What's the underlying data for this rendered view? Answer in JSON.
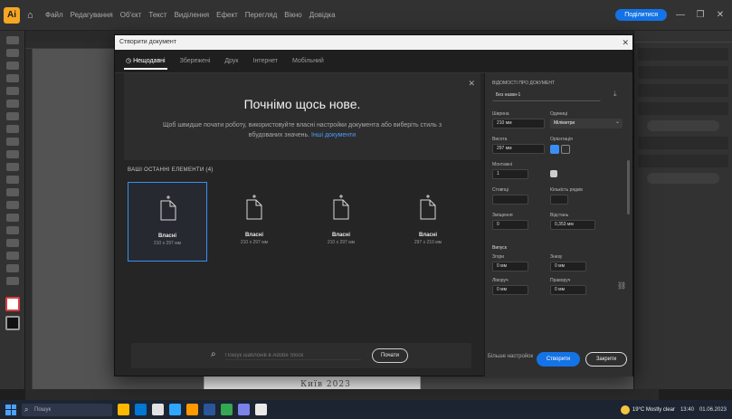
{
  "colors": {
    "accent": "#1473e6",
    "selection": "#3a8ef5",
    "link": "#4b9cff"
  },
  "app": {
    "logo_text": "Ai",
    "menu": [
      "Файл",
      "Редагування",
      "Об'єкт",
      "Текст",
      "Виділення",
      "Ефект",
      "Перегляд",
      "Вікно",
      "Довідка"
    ],
    "share_label": "Поділитися",
    "window_controls": [
      "—",
      "❐",
      "✕"
    ]
  },
  "dialog": {
    "title": "Створити документ",
    "tabs": [
      "Нещодавні",
      "Збережені",
      "Друк",
      "Інтернет",
      "Мобільний"
    ],
    "hero": {
      "title": "Почнімо щось нове.",
      "text": "Щоб швидше почати роботу, використовуйте власні настройки документа або виберіть стиль з вбудованих значень.",
      "link_text": "Інші документи"
    },
    "section_label": "ВАШІ ОСТАННІ ЕЛЕМЕНТИ (4)",
    "presets": [
      {
        "name": "Власні",
        "size": "210 x 297 мм"
      },
      {
        "name": "Власні",
        "size": "210 x 297 мм"
      },
      {
        "name": "Власні",
        "size": "210 x 297 мм"
      },
      {
        "name": "Власні",
        "size": "297 x 210 мм"
      }
    ],
    "search": {
      "placeholder": "Пошук шаблонів в Adobe Stock",
      "button": "Почати"
    },
    "details": {
      "header": "ВІДОМОСТІ ПРО ДОКУМЕНТ",
      "name_value": "Без назви-1",
      "width_label": "Ширина",
      "width_value": "210 мм",
      "units_label": "Одиниці",
      "units_value": "Міліметри",
      "height_label": "Висота",
      "height_value": "297 мм",
      "orientation_label": "Орієнтація",
      "artboards_label": "Монтажні",
      "artboards_value": "1",
      "columns_label": "Стовпці",
      "rows_label": "Кількість рядків",
      "bleed_label": "Випуск",
      "bleed_top_label": "Згори",
      "bleed_top_value": "0 мм",
      "bleed_bottom_label": "Знизу",
      "bleed_bottom_value": "0 мм",
      "bleed_left_label": "Ліворуч",
      "bleed_left_value": "0 мм",
      "bleed_right_label": "Праворуч",
      "bleed_right_value": "0 мм",
      "offset_label": "Зміщення",
      "offset_value": "0",
      "gutter_label": "Відстань",
      "gutter_value": "0,353 мм"
    },
    "more_settings": "Більше настройок",
    "create_label": "Створити",
    "close_label": "Закрити"
  },
  "canvas": {
    "artboard_text": "Київ 2023"
  },
  "taskbar": {
    "search_placeholder": "Пошук",
    "weather": "19°C Mostly clear",
    "time": "13:40",
    "date": "01.06.2023"
  }
}
